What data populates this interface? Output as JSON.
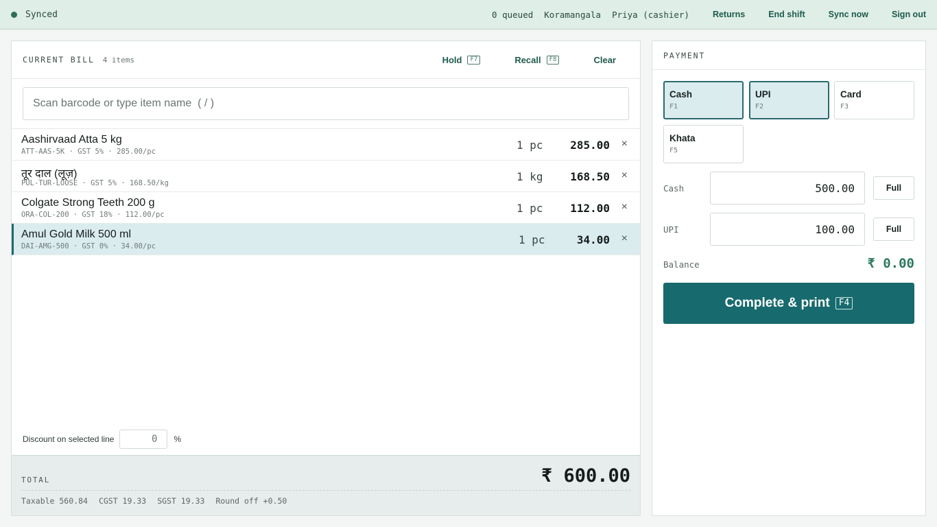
{
  "topbar": {
    "sync_status": "Synced",
    "queued": "0 queued",
    "store": "Koramangala",
    "user": "Priya (cashier)",
    "links": [
      "Returns",
      "End shift",
      "Sync now",
      "Sign out"
    ]
  },
  "bill": {
    "title": "CURRENT BILL",
    "item_count": "4 items",
    "actions": {
      "hold": {
        "label": "Hold",
        "key": "F7"
      },
      "recall": {
        "label": "Recall",
        "key": "F8"
      },
      "clear": {
        "label": "Clear"
      }
    },
    "search_placeholder": "Scan barcode or type item name  ( / )",
    "lines": [
      {
        "name": "Aashirvaad Atta 5 kg",
        "meta": "ATT-AAS-5K · GST 5% · 285.00/pc",
        "qty": "1 pc",
        "amount": "285.00",
        "remove": "×"
      },
      {
        "name": "तूर दाल (लूज़)",
        "meta": "PUL-TUR-LOOSE · GST 5% · 168.50/kg",
        "qty": "1 kg",
        "amount": "168.50",
        "remove": "×"
      },
      {
        "name": "Colgate Strong Teeth 200 g",
        "meta": "ORA-COL-200 · GST 18% · 112.00/pc",
        "qty": "1 pc",
        "amount": "112.00",
        "remove": "×"
      },
      {
        "name": "Amul Gold Milk 500 ml",
        "meta": "DAI-AMG-500 · GST 0% · 34.00/pc",
        "qty": "1 pc",
        "amount": "34.00",
        "remove": "×"
      }
    ],
    "discount": {
      "label": "Discount on selected line",
      "value": "0",
      "unit": "%"
    },
    "total": {
      "label": "TOTAL",
      "amount": "₹ 600.00",
      "taxable": "Taxable 560.84",
      "cgst": "CGST 19.33",
      "sgst": "SGST 19.33",
      "round_off": "Round off +0.50"
    }
  },
  "payment": {
    "title": "PAYMENT",
    "methods": [
      {
        "name": "Cash",
        "key": "F1",
        "active": true
      },
      {
        "name": "UPI",
        "key": "F2",
        "active": true
      },
      {
        "name": "Card",
        "key": "F3",
        "active": false
      },
      {
        "name": "Khata",
        "key": "F5",
        "active": false
      }
    ],
    "cash": {
      "label": "Cash",
      "value": "500.00",
      "full": "Full"
    },
    "upi": {
      "label": "UPI",
      "value": "100.00",
      "full": "Full"
    },
    "balance": {
      "label": "Balance",
      "amount": "₹ 0.00"
    },
    "complete": {
      "label": "Complete & print",
      "key": "F4"
    }
  },
  "colors": {
    "accent": "#176a6e",
    "synced": "#2f6f55",
    "balance": "#2a7a5c"
  }
}
